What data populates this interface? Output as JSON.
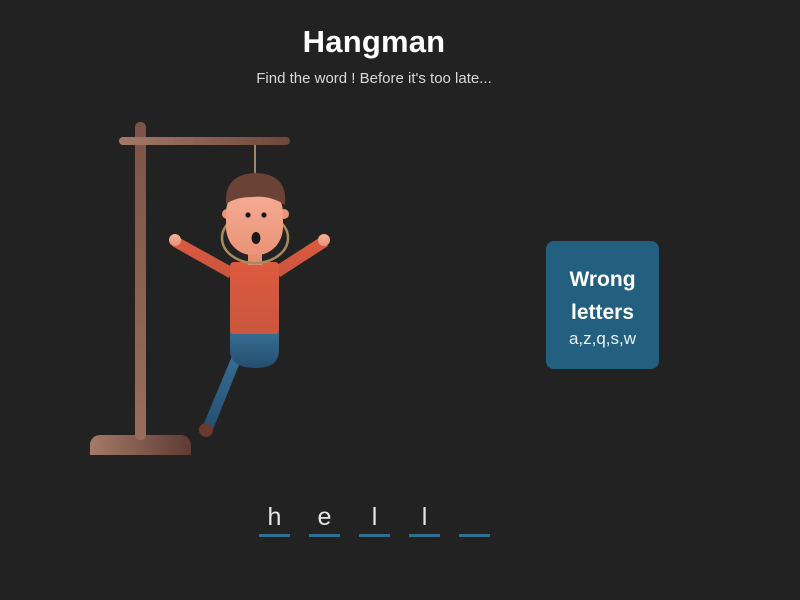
{
  "header": {
    "title": "Hangman",
    "subtitle": "Find the word ! Before it's too late..."
  },
  "wrong_letters": {
    "title_line1": "Wrong",
    "title_line2": "letters",
    "letters": "a,z,q,s,w"
  },
  "word": {
    "slots": [
      "h",
      "e",
      "l",
      "l",
      ""
    ]
  },
  "colors": {
    "background": "#222222",
    "wrong_box": "#23607f",
    "underline": "#2f6f92",
    "gallows": "#8a5a4a",
    "shirt": "#d4573f",
    "pants": "#2d5f84",
    "hair": "#6b4236",
    "skin": "#f2a58b"
  }
}
